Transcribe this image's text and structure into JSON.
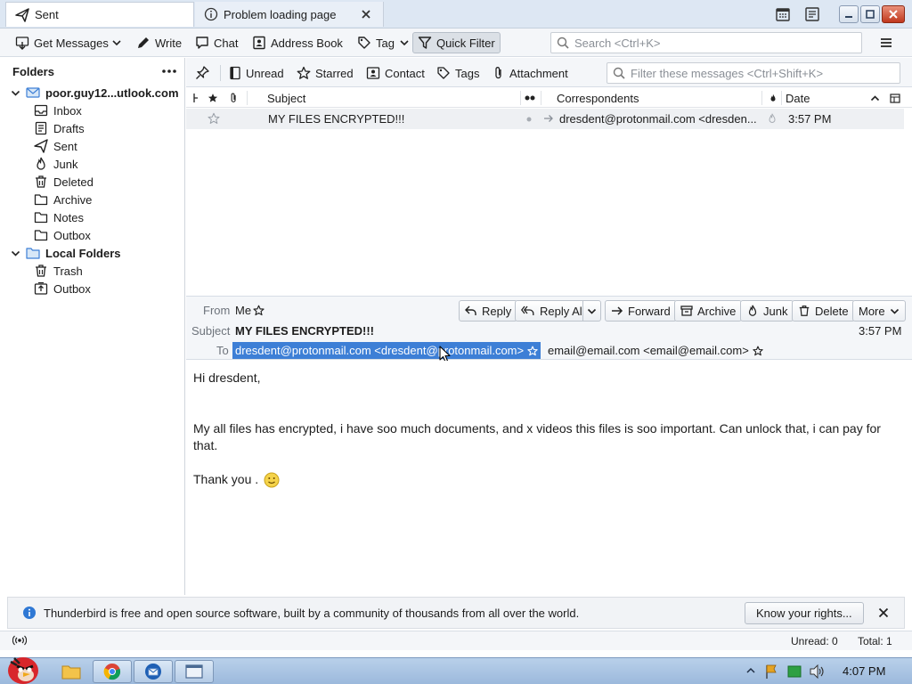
{
  "tabs": [
    {
      "label": "Sent",
      "icon": "send-icon",
      "active": true
    },
    {
      "label": "Problem loading page",
      "icon": "info-icon",
      "active": false
    }
  ],
  "toolbar": {
    "get_messages": "Get Messages",
    "write": "Write",
    "chat": "Chat",
    "address_book": "Address Book",
    "tag": "Tag",
    "quick_filter": "Quick Filter",
    "search_placeholder": "Search <Ctrl+K>"
  },
  "folders": {
    "header": "Folders",
    "account": "poor.guy12...utlook.com",
    "account_items": [
      "Inbox",
      "Drafts",
      "Sent",
      "Junk",
      "Deleted",
      "Archive",
      "Notes",
      "Outbox"
    ],
    "local": "Local Folders",
    "local_items": [
      "Trash",
      "Outbox"
    ]
  },
  "filterbar": {
    "unread": "Unread",
    "starred": "Starred",
    "contact": "Contact",
    "tags": "Tags",
    "attachment": "Attachment",
    "filter_placeholder": "Filter these messages <Ctrl+Shift+K>"
  },
  "thread_columns": {
    "subject": "Subject",
    "correspondents": "Correspondents",
    "date": "Date"
  },
  "messages": [
    {
      "subject": "MY FILES ENCRYPTED!!!",
      "correspondent": "dresdent@protonmail.com <dresden...",
      "date": "3:57 PM"
    }
  ],
  "message_header": {
    "from_label": "From",
    "from_value": "Me",
    "subject_label": "Subject",
    "subject_value": "MY FILES ENCRYPTED!!!",
    "to_label": "To",
    "to_selected": "dresdent@protonmail.com <dresdent@protonmail.com>",
    "to_other": "email@email.com <email@email.com>",
    "date": "3:57 PM",
    "actions": {
      "reply": "Reply",
      "reply_all": "Reply All",
      "forward": "Forward",
      "archive": "Archive",
      "junk": "Junk",
      "delete": "Delete",
      "more": "More"
    }
  },
  "message_body": {
    "greeting": "Hi dresdent,",
    "paragraph": "My all files has encrypted, i have soo much documents, and x videos this files is soo important. Can unlock that, i can pay for that.",
    "closing": "Thank you ."
  },
  "notification": {
    "text": "Thunderbird is free and open source software, built by a community of thousands from all over the world.",
    "button_label": "Know your rights..."
  },
  "status": {
    "unread": "Unread: 0",
    "total": "Total: 1"
  },
  "taskbar": {
    "clock": "4:07 PM"
  },
  "colors": {
    "selection": "#3d7fd6",
    "titlebar": "#dde7f3",
    "taskbar": "#9cb9dc"
  }
}
